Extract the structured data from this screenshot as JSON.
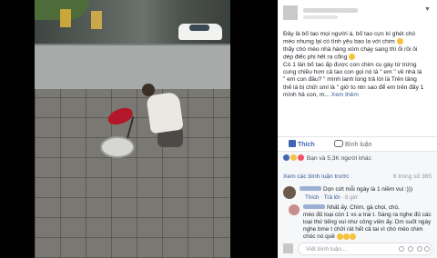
{
  "post": {
    "text_lines": [
      "Đây là bố tao mọi người à, bố tao cực kì ghét chó",
      "mèo nhưng lại có tình yêu bao la với chim ",
      "thấy chó mèo nhà hàng xóm chạy sang thì ối rồi ôi",
      "dép điếc phi hết ra cổng ",
      "Có 1 lần bố tao ấp được con chim cu gáy từ trứng",
      "cung chiều hơn cả tao con gọi nó là \" em \" về nhà là",
      "\" em con đâu? \" mình lanh lùng trả lời là Trên tầng",
      "thế là bị chửi sml là \" giờ to ntn sao để em trên đấy 1",
      "mình hả con, m..."
    ],
    "see_more": "Xem thêm"
  },
  "actions": {
    "like": "Thích",
    "comment": "Bình luận"
  },
  "reactions": {
    "summary": "Bạn và 5,3K người khác",
    "colors": {
      "like": "#4267b2",
      "haha": "#f5c33b",
      "love": "#f25268"
    }
  },
  "comments": {
    "view_previous": "Xem các bình luận trước",
    "count": "6 trong số 365",
    "items": [
      {
        "text": "Dọn cứt mỗi ngày là 1 niềm vui :)))",
        "meta_like": "Thích",
        "meta_reply": "Trả lời",
        "meta_time": "8 giờ"
      },
      {
        "text_lines": [
          "Nhất ấy. Chim, gà chọi, chó,",
          "mèo đủ loại còn 1 vs a trai t. Sáng ra nghe đủ các",
          "loại thứ tiếng vui như công viên ấy. Dm suốt ngày",
          "nghe bme t chửi rát hết cả tai vì chó mèo chim",
          "chóc nó quê "
        ]
      }
    ],
    "write_placeholder": "Viết bình luận..."
  }
}
